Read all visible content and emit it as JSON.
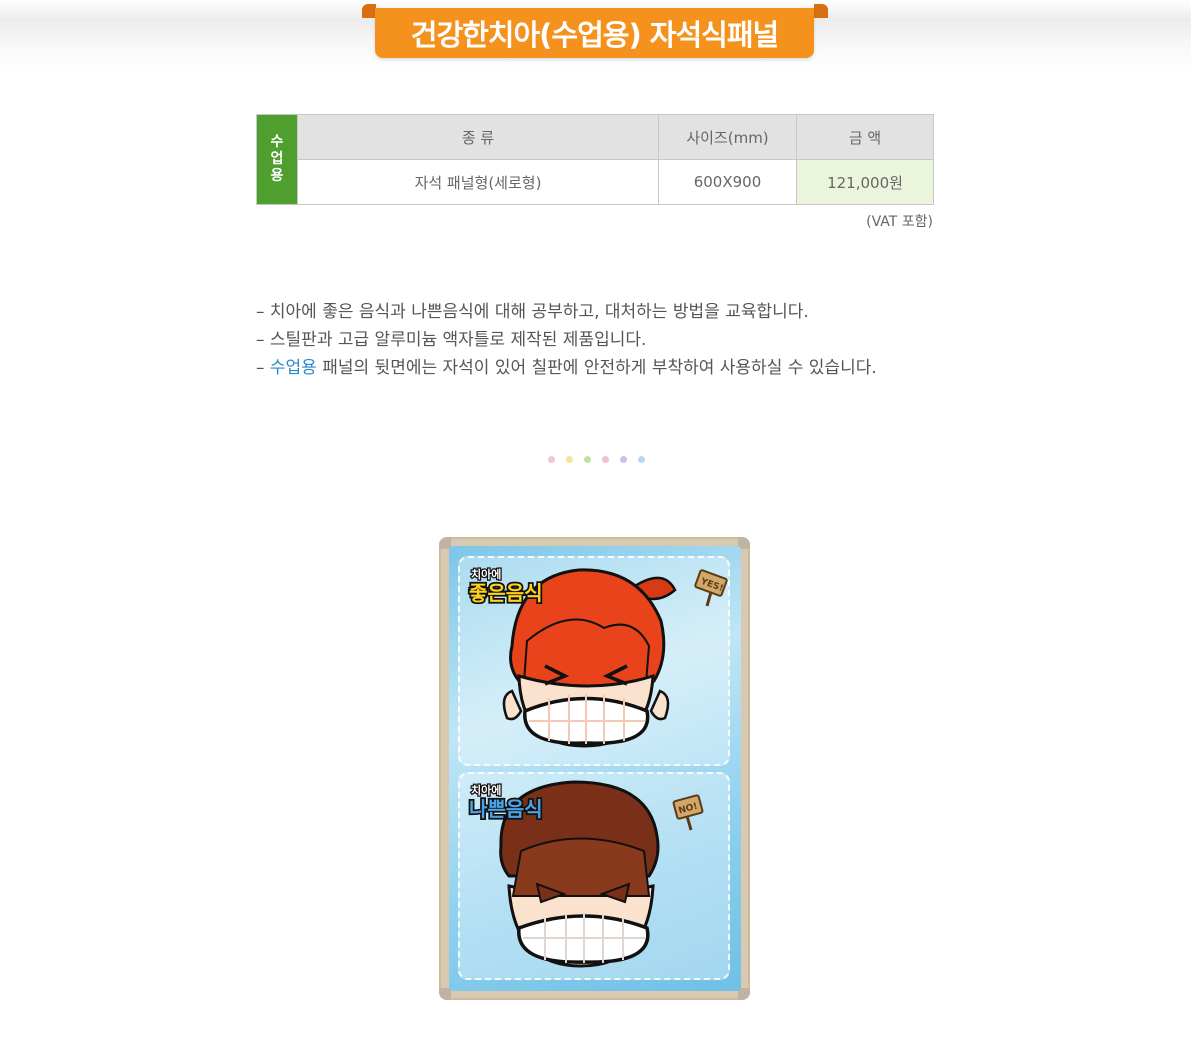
{
  "header": {
    "title": "건강한치아(수업용) 자석식패널"
  },
  "table": {
    "side_label": "수업용",
    "columns": [
      "종 류",
      "사이즈(mm)",
      "금 액"
    ],
    "rows": [
      {
        "type": "자석 패널형(세로형)",
        "size": "600X900",
        "price": "121,000원"
      }
    ],
    "note": "(VAT 포함)"
  },
  "description": [
    {
      "prefix": "– ",
      "highlight": "",
      "text": "치아에 좋은 음식과 나쁜음식에 대해 공부하고, 대처하는 방법을 교육합니다."
    },
    {
      "prefix": "– ",
      "highlight": "",
      "text": "스틸판과 고급 알루미늄 액자틀로 제작된 제품입니다."
    },
    {
      "prefix": "– ",
      "highlight": "수업용",
      "text": " 패널의 뒷면에는 자석이 있어 칠판에 안전하게 부착하여 사용하실 수 있습니다."
    }
  ],
  "divider_dot_colors": [
    "#f3c6d3",
    "#f4e39d",
    "#bde39f",
    "#f2bfd2",
    "#c9c2e6",
    "#b6d8f3"
  ],
  "panel": {
    "top_card": {
      "heading_small": "치아에",
      "heading_big": "좋은음식",
      "sign": "YES!"
    },
    "bottom_card": {
      "heading_small": "치아에",
      "heading_big": "나쁜음식",
      "sign": "NO!"
    }
  },
  "colors": {
    "accent_orange": "#f5921e",
    "side_green": "#4f9f2f",
    "highlight_blue": "#2c8ac8",
    "amount_bg": "#ebf5dc"
  }
}
